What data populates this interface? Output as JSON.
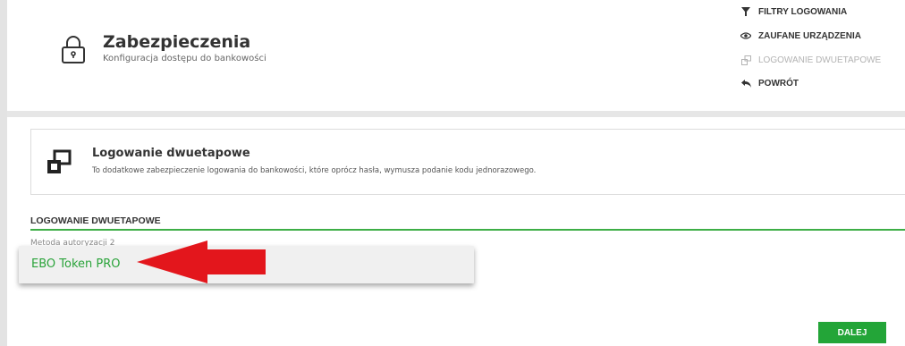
{
  "header": {
    "title": "Zabezpieczenia",
    "subtitle": "Konfiguracja dostępu do bankowości",
    "icon": "lock-icon"
  },
  "side_menu": {
    "items": [
      {
        "label": "FILTRY LOGOWANIA",
        "icon": "filter-icon",
        "active": true
      },
      {
        "label": "ZAUFANE URZĄDZENIA",
        "icon": "eye-icon",
        "active": true
      },
      {
        "label": "LOGOWANIE DWUETAPOWE",
        "icon": "two-step-icon",
        "active": false
      },
      {
        "label": "POWRÓT",
        "icon": "back-arrow-icon",
        "active": true
      }
    ]
  },
  "info_card": {
    "title": "Logowanie dwuetapowe",
    "description": "To dodatkowe zabezpieczenie logowania do bankowości, które oprócz hasła, wymusza podanie kodu jednorazowego.",
    "icon": "two-step-icon"
  },
  "section": {
    "heading": "LOGOWANIE DWUETAPOWE",
    "field_label": "Metoda autoryzacji 2",
    "dropdown_option": "EBO Token PRO"
  },
  "actions": {
    "next_label": "DALEJ"
  },
  "colors": {
    "accent_green": "#23a538",
    "annotation_red": "#e3161c"
  }
}
